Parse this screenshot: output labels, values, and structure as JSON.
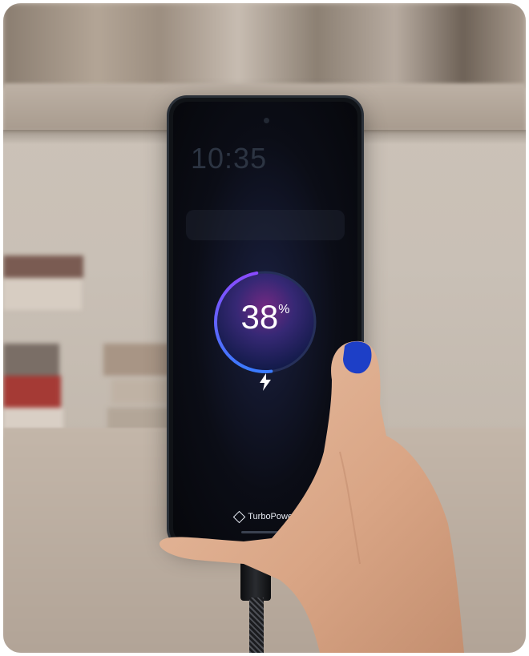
{
  "phone_screen": {
    "battery_percent": "38",
    "percent_sign": "%",
    "lock_time": "10:35",
    "brand_label": "TurboPower",
    "charge_level": 0.38
  },
  "colors": {
    "ring_accent": "#3b6bff",
    "ring_glow": "#7b3cff",
    "nail_polish": "#1d3fc7"
  }
}
